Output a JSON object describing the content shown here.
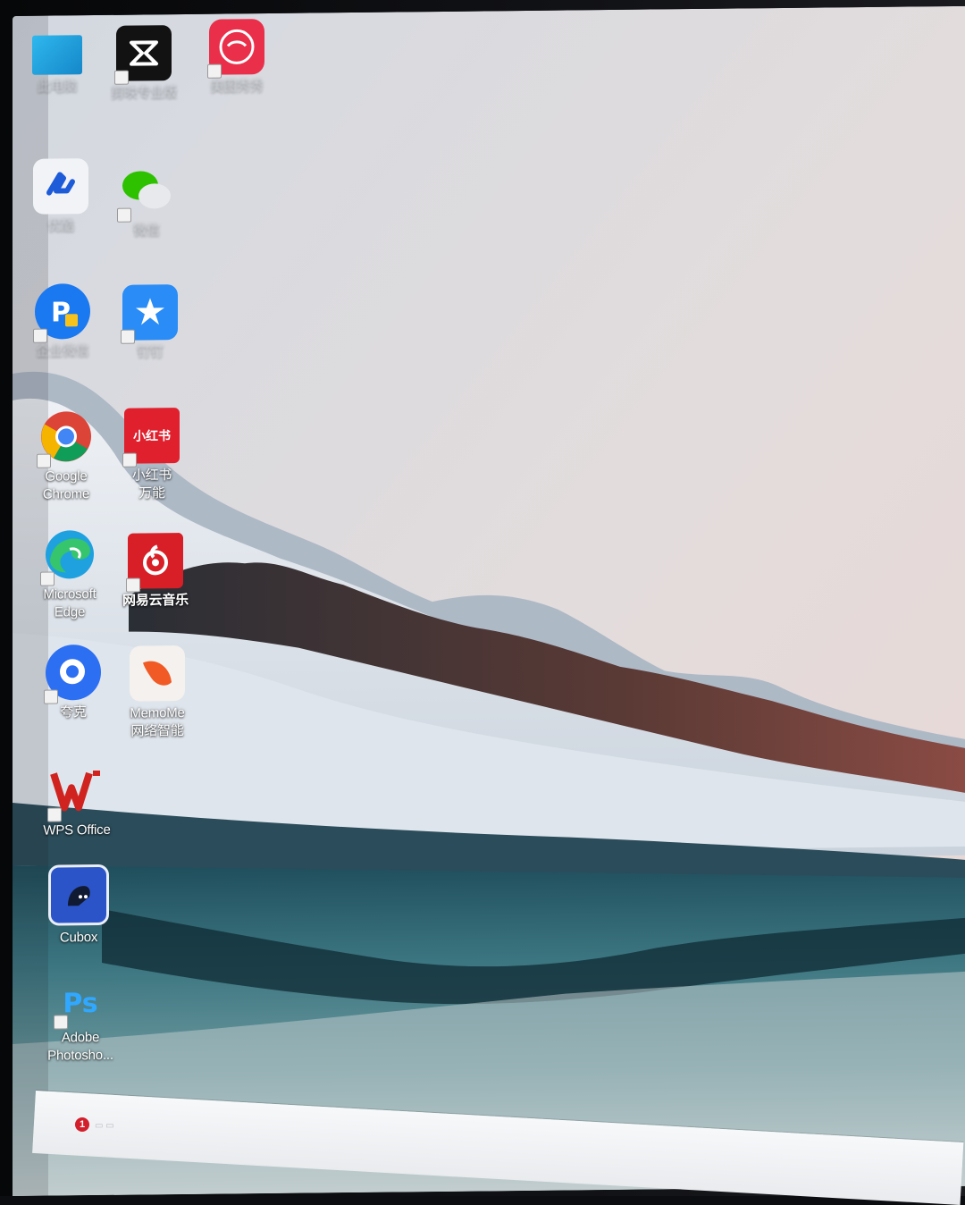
{
  "desktop": {
    "icons": [
      {
        "name": "此电脑",
        "id": "this-pc"
      },
      {
        "name": "剪映专业版",
        "id": "capcut"
      },
      {
        "name": "美图秀秀",
        "id": "meitu"
      },
      {
        "name": "优酷",
        "id": "youku"
      },
      {
        "name": "微信",
        "id": "wechat"
      },
      {
        "name": "企业微信",
        "id": "pp-app"
      },
      {
        "name": "钉钉",
        "id": "dingtalk"
      },
      {
        "name": "Google\nChrome",
        "id": "google-chrome"
      },
      {
        "name": "小红书\n万能",
        "id": "xiaohongshu"
      },
      {
        "name": "Microsoft\nEdge",
        "id": "microsoft-edge"
      },
      {
        "name": "网易云音乐",
        "id": "netease-music"
      },
      {
        "name": "夸克",
        "id": "quark"
      },
      {
        "name": "MemoMe\n网络智能",
        "id": "memome"
      },
      {
        "name": "WPS Office",
        "id": "wps-office"
      },
      {
        "name": "Cubox",
        "id": "cubox"
      },
      {
        "name": "Adobe\nPhotosho...",
        "id": "adobe-photoshop"
      }
    ],
    "glyph_text": {
      "xiaohongshu": "小红书",
      "photoshop": "Ps"
    }
  },
  "taskbar": {
    "notification_count": "1"
  },
  "colors": {
    "sky_top": "#d7dbe2",
    "sky_bottom": "#e7d9d7",
    "water": "#3f7880",
    "accent_red": "#e5333f"
  }
}
